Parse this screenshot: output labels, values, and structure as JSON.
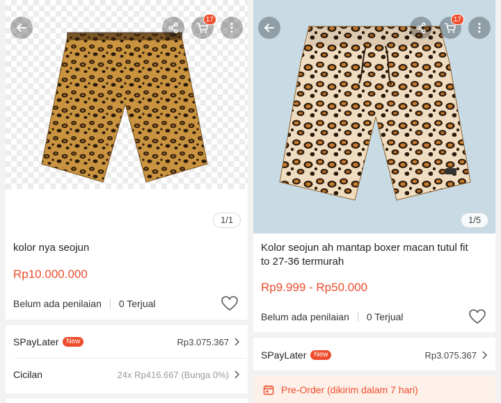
{
  "colors": {
    "accent": "#ee4d2d",
    "muted": "#9a9a9a"
  },
  "panels": [
    {
      "image_counter": "1/1",
      "cart_badge": "17",
      "title": "kolor nya seojun",
      "price": "Rp10.000.000",
      "rating_text": "Belum ada penilaian",
      "sold_text": "0 Terjual",
      "spaylater": {
        "label": "SPayLater",
        "badge": "New",
        "value": "Rp3.075.367"
      },
      "cicilan": {
        "label": "Cicilan",
        "value": "24x Rp416.667 (Bunga 0%)"
      }
    },
    {
      "image_counter": "1/5",
      "cart_badge": "17",
      "title_line1": "Kolor seojun ah mantap boxer macan tutul fit",
      "title_line2": "to 27-36 termurah",
      "price": "Rp9.999 - Rp50.000",
      "rating_text": "Belum ada penilaian",
      "sold_text": "0 Terjual",
      "spaylater": {
        "label": "SPayLater",
        "badge": "New",
        "value": "Rp3.075.367"
      },
      "preorder": "Pre-Order (dikirim dalam 7 hari)"
    }
  ],
  "icons": [
    "back-arrow-icon",
    "share-icon",
    "cart-icon",
    "more-icon",
    "heart-icon",
    "chevron-right-icon",
    "calendar-icon"
  ]
}
